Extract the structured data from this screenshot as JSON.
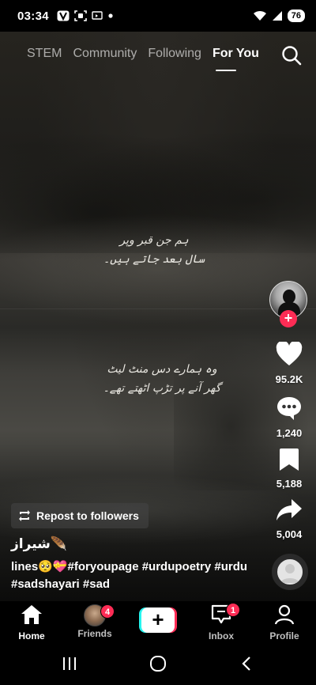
{
  "status_bar": {
    "time": "03:34",
    "battery": "76",
    "icons": [
      "v-badge-icon",
      "screenshot-icon",
      "cast-icon",
      "dot-icon",
      "wifi-icon",
      "signal-icon"
    ]
  },
  "top_nav": {
    "tabs": [
      {
        "label": "STEM",
        "active": false
      },
      {
        "label": "Community",
        "active": false
      },
      {
        "label": "Following",
        "active": false
      },
      {
        "label": "For You",
        "active": true
      }
    ]
  },
  "video": {
    "poem_top": [
      "ہم جن قبر وپر",
      "سال بعد جاتے ہیں۔"
    ],
    "poem_bottom": [
      "وہ ہمارے دس منٹ لیٹ",
      "گھر آنے پر تڑپ اٹھتے تھے۔"
    ]
  },
  "actions": {
    "likes": "95.2K",
    "comments": "1,240",
    "saves": "5,188",
    "shares": "5,004"
  },
  "post": {
    "repost_label": "Repost to followers",
    "username": "شیراز🪶",
    "caption": "lines🥺💝#foryoupage #urdupoetry #urdu #sadshayari #sad"
  },
  "bottom_nav": {
    "home": "Home",
    "friends": "Friends",
    "friends_badge": "4",
    "inbox": "Inbox",
    "inbox_badge": "1",
    "profile": "Profile"
  },
  "colors": {
    "accent": "#fe2c55",
    "cyan": "#25f4ee"
  }
}
